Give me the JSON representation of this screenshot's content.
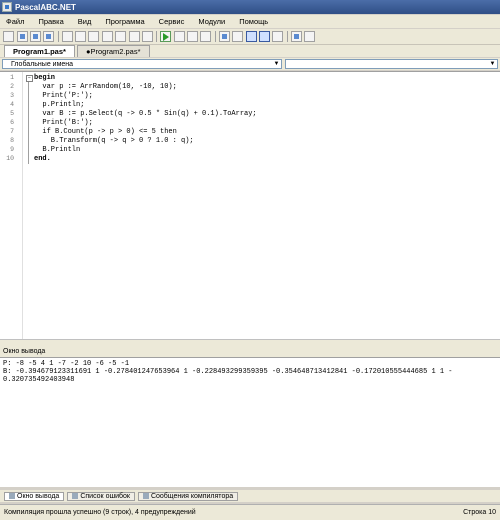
{
  "app": {
    "title": "PascalABC.NET"
  },
  "menu": [
    "Файл",
    "Правка",
    "Вид",
    "Программа",
    "Сервис",
    "Модули",
    "Помощь"
  ],
  "tabs": [
    {
      "label": "Program1.pas*",
      "active": true
    },
    {
      "label": "●Program2.pas*",
      "active": false
    }
  ],
  "combo": {
    "scope": "Глобальные имена",
    "member": ""
  },
  "editor": {
    "lines": [
      {
        "n": "1",
        "text": "begin"
      },
      {
        "n": "2",
        "text": "  var p := ArrRandom(10, -10, 10);"
      },
      {
        "n": "3",
        "text": "  Print('P:');"
      },
      {
        "n": "4",
        "text": "  p.Println;"
      },
      {
        "n": "5",
        "text": "  var B := p.Select(q -> 0.5 * Sin(q) + 0.1).ToArray;"
      },
      {
        "n": "6",
        "text": "  Print('B:');"
      },
      {
        "n": "7",
        "text": "  if B.Count(p -> p > 0) <= 5 then"
      },
      {
        "n": "8",
        "text": "    B.Transform(q -> q > 0 ? 1.0 : q);"
      },
      {
        "n": "9",
        "text": "  B.Println"
      },
      {
        "n": "10",
        "text": "end."
      }
    ]
  },
  "output": {
    "header": "Окно вывода",
    "text": "P: -8 -5 4 1 -7 -2 10 -6 -5 -1\nB: -0.394679123311691 1 -0.278401247653964 1 -0.228493299359395 -0.354648713412841 -0.172010555444685 1 1 -\n0.320735492403948"
  },
  "bottom_tabs": [
    "Окно вывода",
    "Список ошибок",
    "Сообщения компилятора"
  ],
  "status": {
    "message": "Компиляция прошла успешно (9 строк), 4 предупреждений",
    "position": "Строка 10"
  }
}
